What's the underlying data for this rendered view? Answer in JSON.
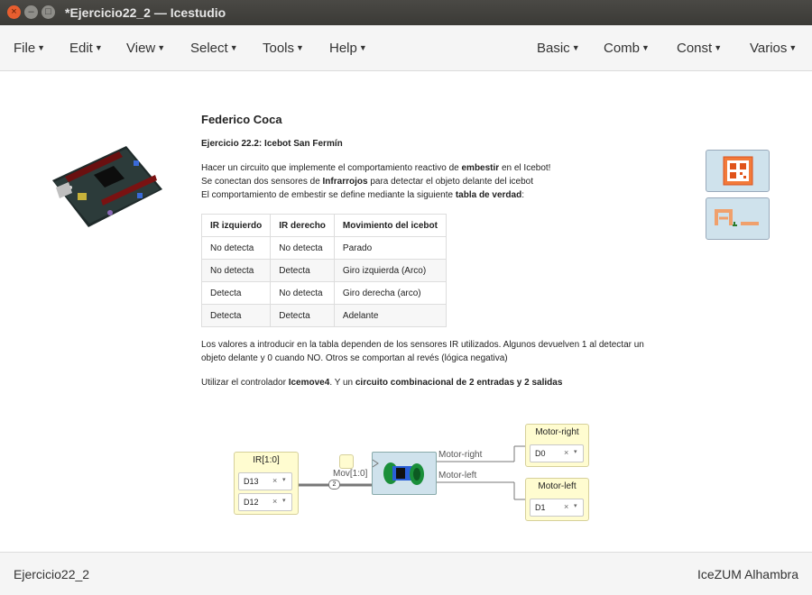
{
  "window": {
    "title": "*Ejercicio22_2 — Icestudio"
  },
  "menubar": {
    "left": [
      {
        "label": "File"
      },
      {
        "label": "Edit"
      },
      {
        "label": "View"
      },
      {
        "label": "Select"
      },
      {
        "label": "Tools"
      },
      {
        "label": "Help"
      }
    ],
    "right": [
      {
        "label": "Basic"
      },
      {
        "label": "Comb"
      },
      {
        "label": "Const"
      },
      {
        "label": "Varios"
      }
    ]
  },
  "info": {
    "author": "Federico Coca",
    "subtitle": "Ejercicio 22.2: Icebot San Fermín",
    "p1": {
      "l1a": "Hacer un circuito que implemente el comportamiento reactivo de ",
      "l1b": "embestir",
      "l1c": " en el Icebot!",
      "l2a": "Se conectan dos sensores de ",
      "l2b": "Infrarrojos",
      "l2c": " para detectar el objeto delante del icebot",
      "l3a": "El comportamiento de embestir se define mediante la siguiente ",
      "l3b": "tabla de verdad",
      "l3c": ":"
    },
    "table": {
      "headers": [
        "IR izquierdo",
        "IR derecho",
        "Movimiento del icebot"
      ],
      "rows": [
        [
          "No detecta",
          "No detecta",
          "Parado"
        ],
        [
          "No detecta",
          "Detecta",
          "Giro izquierda (Arco)"
        ],
        [
          "Detecta",
          "No detecta",
          "Giro derecha (arco)"
        ],
        [
          "Detecta",
          "Detecta",
          "Adelante"
        ]
      ]
    },
    "p2": {
      "l1": "Los valores a introducir en la tabla dependen de los sensores IR utilizados. Algunos devuelven 1 al detectar un",
      "l2": "objeto delante y 0 cuando NO. Otros se comportan al revés (lógica negativa)"
    },
    "p3": {
      "a": "Utilizar el controlador ",
      "b": "Icemove4",
      "c": ". Y un ",
      "d": "circuito combinacional de 2 entradas y 2 salidas"
    }
  },
  "circuit": {
    "input_block": {
      "title": "IR[1:0]",
      "pins": [
        {
          "value": "D13",
          "clear": "×",
          "dropdown": "▾"
        },
        {
          "value": "D12",
          "clear": "×",
          "dropdown": "▾"
        }
      ]
    },
    "bus_label": "Mov[1:0]",
    "bus_width": "2",
    "out_labels": [
      "Motor-right",
      "Motor-left"
    ],
    "output_blocks": [
      {
        "title": "Motor-right",
        "pin": {
          "value": "D0",
          "clear": "×",
          "dropdown": "▾"
        }
      },
      {
        "title": "Motor-left",
        "pin": {
          "value": "D1",
          "clear": "×",
          "dropdown": "▾"
        }
      }
    ]
  },
  "statusbar": {
    "project": "Ejercicio22_2",
    "board": "IceZUM Alhambra"
  },
  "icons": {
    "close": "close-icon",
    "minimize": "minimize-icon",
    "maximize": "maximize-icon",
    "menu_caret": "caret-down-icon"
  },
  "colors": {
    "accent_orange": "#e85e2f",
    "block_yellow": "#fffcd0",
    "wire": "#777777"
  }
}
